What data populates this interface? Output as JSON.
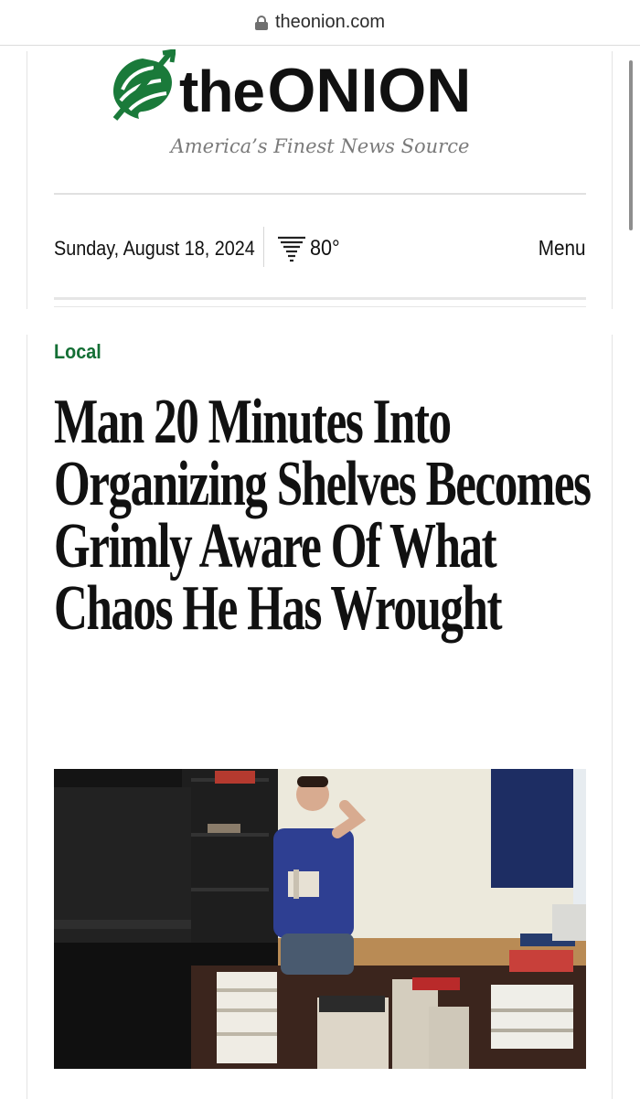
{
  "browser": {
    "url": "theonion.com",
    "lock_icon": "lock-icon"
  },
  "masthead": {
    "logo_icon": "onion-logo-icon",
    "brand_the": "the",
    "brand_onion": "ONION",
    "tagline": "America’s Finest News Source",
    "brand_color": "#1a7a3a"
  },
  "infobar": {
    "date": "Sunday, August 18, 2024",
    "weather_icon": "tornado-icon",
    "temperature": "80°",
    "menu_label": "Menu"
  },
  "article": {
    "section": "Local",
    "section_color": "#146f35",
    "headline": "Man 20 Minutes Into Organizing Shelves Becomes Grimly Aware Of What Chaos He Has Wrought",
    "image_icon": "article-photo"
  }
}
